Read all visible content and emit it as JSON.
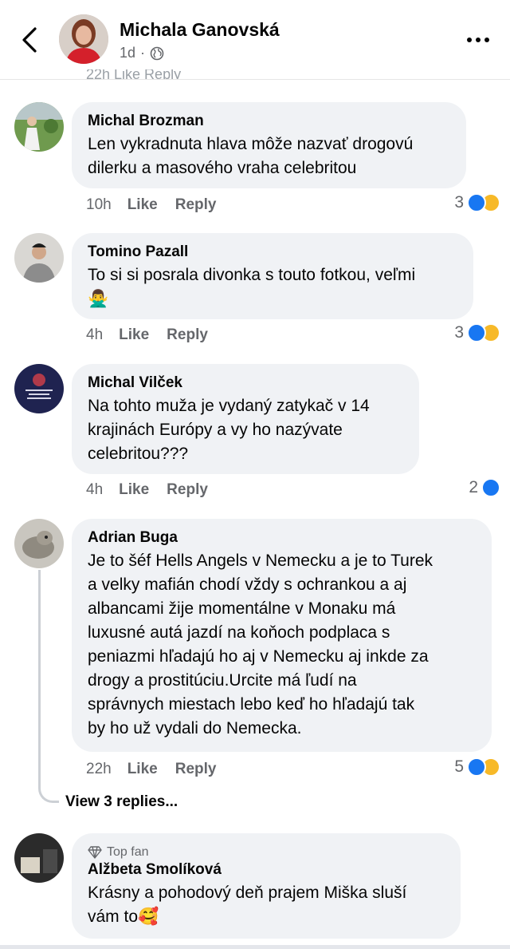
{
  "header": {
    "name": "Michala Ganovská",
    "time": "1d",
    "dot": "·",
    "peek": "22h    Like    Reply"
  },
  "comments": [
    {
      "author": "Michal Brozman",
      "lines": [
        "Len vykradnuta hlava môže nazvať drogovú",
        "dilerku a masového vraha celebritou"
      ],
      "time": "10h",
      "like": "Like",
      "reply": "Reply",
      "count": "3",
      "reactions": [
        "like-icon",
        "haha-icon"
      ]
    },
    {
      "author": "Tomino Pazall",
      "lines": [
        "To si si posrala divonka s touto fotkou, veľmi",
        "🙅‍♂️"
      ],
      "time": "4h",
      "like": "Like",
      "reply": "Reply",
      "count": "3",
      "reactions": [
        "like-icon",
        "haha-icon"
      ]
    },
    {
      "author": "Michal Vilček",
      "lines": [
        "Na tohto muža je vydaný zatykač v 14",
        "krajinách Európy a vy ho nazývate",
        "celebritou???"
      ],
      "time": "4h",
      "like": "Like",
      "reply": "Reply",
      "count": "2",
      "reactions": [
        "like-icon"
      ]
    },
    {
      "author": "Adrian Buga",
      "lines": [
        "Je to šéf Hells Angels v Nemecku a je to Turek",
        "a velky  mafián chodí vždy s ochrankou a aj",
        "albancami žije momentálne v Monaku má",
        "luxusné autá jazdí na koňoch podplaca s",
        "peniazmi hľadajú ho aj v Nemecku aj inkde za",
        "drogy a prostitúciu.Urcite má ľudí na",
        "správnych miestach lebo keď ho hľadajú tak",
        "by ho už vydali do Nemecka."
      ],
      "time": "22h",
      "like": "Like",
      "reply": "Reply",
      "count": "5",
      "reactions": [
        "like-icon",
        "haha-icon"
      ],
      "view_replies": "View 3 replies..."
    },
    {
      "badge": "Top fan",
      "author": "Alžbeta Smolíková",
      "lines": [
        "Krásny a pohodový deň prajem Miška sluší",
        "vám to🥰"
      ]
    }
  ],
  "colors": {
    "like_blue": "#1877f2",
    "haha_yellow": "#f7b928",
    "bubble_bg": "#f0f2f5",
    "meta_gray": "#65676b"
  }
}
